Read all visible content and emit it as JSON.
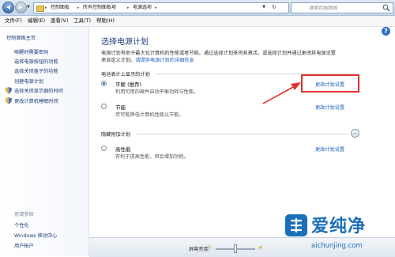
{
  "window": {
    "breadcrumbs": [
      "控制面板",
      "所有控制面板项",
      "电源选项"
    ],
    "search_placeholder": "搜索控制面板"
  },
  "menu": [
    "文件(F)",
    "编辑(E)",
    "查看(V)",
    "工具(T)",
    "帮助(H)"
  ],
  "sidebar": {
    "home": "控制面板主页",
    "links": [
      "唤醒时需要密码",
      "选择电源按钮的功能",
      "选择关闭盖子的功能",
      "创建电源计划",
      "选择关闭显示器的时间",
      "更改计算机睡眠时间"
    ],
    "see_also_title": "另请参阅",
    "see_also": [
      "个性化",
      "Windows 移动中心",
      "用户帐户"
    ]
  },
  "main": {
    "title": "选择电源计划",
    "desc_line1": "电源计划有助于最大化计算机的性能或者节能。通过选择计划来将其激活，或选择计划并通过更改其电源设置",
    "desc_line2_prefix": "来自定义计划。",
    "desc_link": "请提供电源计划的详细信息",
    "group1_title": "电池表计上显示的计划",
    "plans": [
      {
        "name": "平衡 (推荐)",
        "desc": "利用可用的硬件自动平衡功耗与性能。",
        "link": "更改计划设置",
        "checked": true
      },
      {
        "name": "节能",
        "desc": "尽可能降低计算机性能以节能。",
        "link": "更改计划设置",
        "checked": false
      }
    ],
    "group2_title": "隐藏附加计划",
    "extra_plans": [
      {
        "name": "高性能",
        "desc": "有利于提高性能，但会增加功耗。",
        "link": "更改计划设置",
        "checked": false
      }
    ]
  },
  "bottom": {
    "brightness_label": "屏幕亮度:",
    "brightness_level": 0.5
  },
  "watermark": {
    "text": "爱纯净",
    "url": "aichunjing.com"
  },
  "colors": {
    "highlight": "#e2312d",
    "link": "#1f5fbf"
  }
}
